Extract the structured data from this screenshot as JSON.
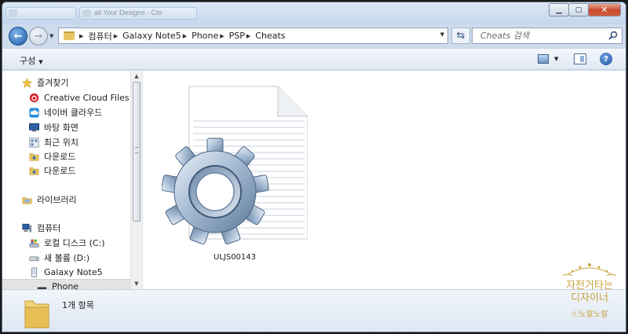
{
  "window": {
    "tab_titles": [
      "",
      "all Your Designs - Cor"
    ]
  },
  "address": {
    "path": [
      "컴퓨터",
      "Galaxy Note5",
      "Phone",
      "PSP",
      "Cheats"
    ]
  },
  "search": {
    "placeholder": "Cheats 검색"
  },
  "toolbar": {
    "organize_label": "구성"
  },
  "sidebar": {
    "favorites": {
      "label": "즐겨찾기",
      "items": [
        {
          "label": "Creative Cloud Files",
          "icon": "creative-cloud-icon"
        },
        {
          "label": "네이버 클라우드",
          "icon": "cloud-icon"
        },
        {
          "label": "바탕 화면",
          "icon": "desktop-icon"
        },
        {
          "label": "최근 위치",
          "icon": "recent-places-icon"
        },
        {
          "label": "다운로드",
          "icon": "download-folder-icon"
        },
        {
          "label": "다운로드",
          "icon": "download-folder-icon"
        }
      ]
    },
    "libraries": {
      "label": "라이브러리"
    },
    "computer": {
      "label": "컴퓨터",
      "items": [
        {
          "label": "로컬 디스크 (C:)",
          "icon": "local-disk-icon"
        },
        {
          "label": "새 볼륨 (D:)",
          "icon": "drive-icon"
        },
        {
          "label": "Galaxy Note5",
          "icon": "phone-device-icon"
        },
        {
          "label": "Phone",
          "icon": "phone-storage-icon"
        }
      ]
    }
  },
  "files": [
    {
      "name": "ULJS00143",
      "icon": "system-file-gear-icon"
    }
  ],
  "details": {
    "item_count": "1개 항목"
  },
  "watermark": {
    "line1": "자전거타는",
    "line2": "디자이너",
    "line3": "ⓒ노랄노랄"
  },
  "colors": {
    "accent": "#1f5ea8",
    "window_frame": "#cfdcec",
    "close_button": "#c7492c",
    "watermark": "#c9a23e"
  }
}
